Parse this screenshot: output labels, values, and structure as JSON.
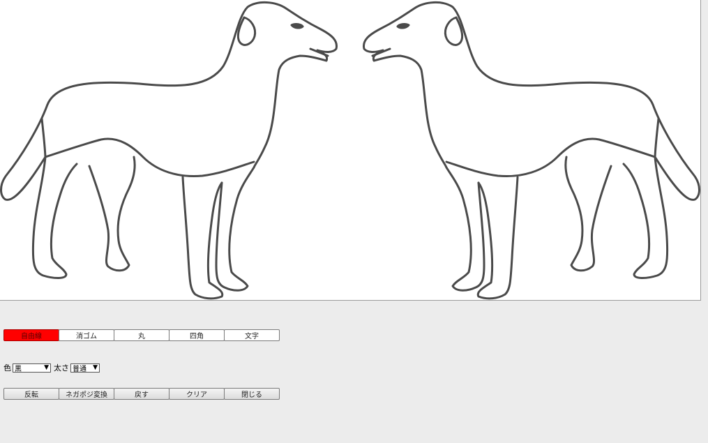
{
  "tools": [
    {
      "label": "自由線",
      "active": true
    },
    {
      "label": "消ゴム",
      "active": false
    },
    {
      "label": "丸",
      "active": false
    },
    {
      "label": "四角",
      "active": false
    },
    {
      "label": "文字",
      "active": false
    }
  ],
  "options": {
    "color_label": "色",
    "color_value": "黒",
    "size_label": "太さ",
    "size_value": "普通"
  },
  "actions": [
    {
      "label": "反転"
    },
    {
      "label": "ネガポジ変換"
    },
    {
      "label": "戻す"
    },
    {
      "label": "クリア"
    },
    {
      "label": "閉じる"
    }
  ],
  "colors": {
    "active_tool": "#ff0000",
    "stroke": "#4a4a4a",
    "canvas": "#ffffff",
    "background": "#ececec"
  }
}
